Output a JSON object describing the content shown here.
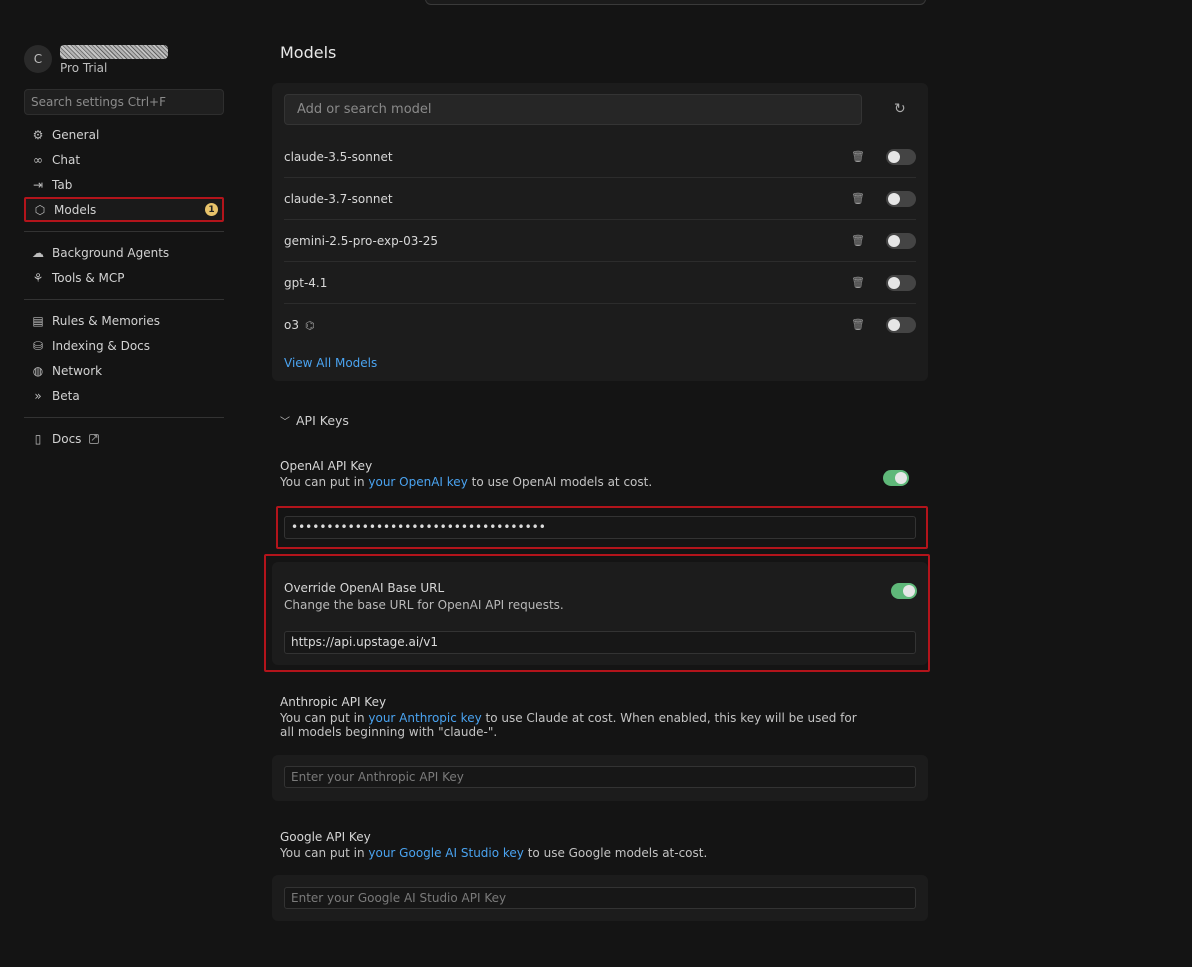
{
  "sidebar": {
    "avatar_letter": "C",
    "plan": "Pro Trial",
    "search_placeholder": "Search settings Ctrl+F",
    "groups": [
      [
        {
          "label": "General",
          "icon": "gear-icon"
        },
        {
          "label": "Chat",
          "icon": "infinity-icon"
        },
        {
          "label": "Tab",
          "icon": "arrow-right-icon"
        },
        {
          "label": "Models",
          "icon": "cube-icon",
          "active": true,
          "badge": "1"
        }
      ],
      [
        {
          "label": "Background Agents",
          "icon": "cloud-icon"
        },
        {
          "label": "Tools & MCP",
          "icon": "nodes-icon"
        }
      ],
      [
        {
          "label": "Rules & Memories",
          "icon": "clipboard-icon"
        },
        {
          "label": "Indexing & Docs",
          "icon": "database-icon"
        },
        {
          "label": "Network",
          "icon": "globe-icon"
        },
        {
          "label": "Beta",
          "icon": "double-chevron-icon"
        }
      ],
      [
        {
          "label": "Docs",
          "icon": "book-icon"
        }
      ]
    ]
  },
  "main": {
    "title": "Models",
    "model_search_placeholder": "Add or search model",
    "models": [
      {
        "name": "claude-3.5-sonnet",
        "enabled": false
      },
      {
        "name": "claude-3.7-sonnet",
        "enabled": false
      },
      {
        "name": "gemini-2.5-pro-exp-03-25",
        "enabled": false
      },
      {
        "name": "gpt-4.1",
        "enabled": false
      },
      {
        "name": "o3",
        "enabled": false,
        "brain": true
      }
    ],
    "view_all": "View All Models",
    "api_keys_heading": "API Keys",
    "openai": {
      "label": "OpenAI API Key",
      "desc_before": "You can put in ",
      "desc_link": "your OpenAI key",
      "desc_after": " to use OpenAI models at cost.",
      "enabled": true,
      "value": "••••••••••••••••••••••••••••••••••••"
    },
    "override": {
      "label": "Override OpenAI Base URL",
      "desc": "Change the base URL for OpenAI API requests.",
      "enabled": true,
      "value": "https://api.upstage.ai/v1"
    },
    "anthropic": {
      "label": "Anthropic API Key",
      "desc_before": "You can put in ",
      "desc_link": "your Anthropic key",
      "desc_after": " to use Claude at cost. When enabled, this key will be used for all models beginning with \"claude-\".",
      "placeholder": "Enter your Anthropic API Key"
    },
    "google": {
      "label": "Google API Key",
      "desc_before": "You can put in ",
      "desc_link": "your Google AI Studio key",
      "desc_after": " to use Google models at-cost.",
      "placeholder": "Enter your Google AI Studio API Key"
    }
  },
  "colors": {
    "accent_link": "#4aa3f0",
    "toggle_on": "#5fb879",
    "highlight_outline": "#b3141b",
    "badge": "#e8c36a"
  }
}
